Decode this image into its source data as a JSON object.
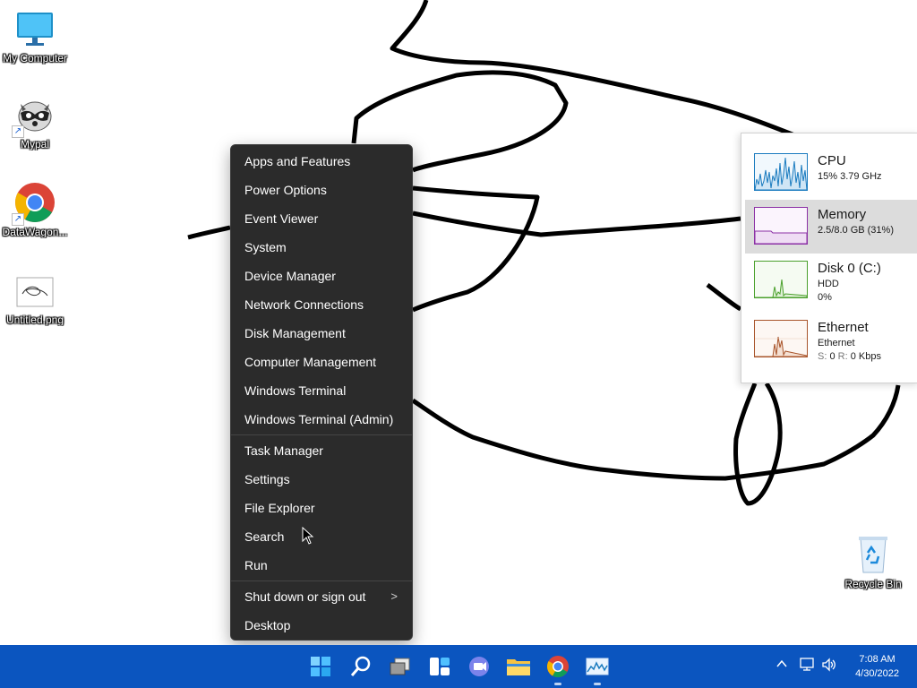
{
  "desktop": {
    "icons": [
      {
        "label": "My Computer",
        "icon": "monitor-icon"
      },
      {
        "label": "Mypal",
        "icon": "raccoon-browser-icon"
      },
      {
        "label": "DataWagon...",
        "icon": "chrome-icon"
      },
      {
        "label": "Untitled.png",
        "icon": "image-file-icon"
      },
      {
        "label": "Recycle Bin",
        "icon": "recycle-bin-icon"
      }
    ]
  },
  "winx_menu": {
    "items": [
      "Apps and Features",
      "Power Options",
      "Event Viewer",
      "System",
      "Device Manager",
      "Network Connections",
      "Disk Management",
      "Computer Management",
      "Windows Terminal",
      "Windows Terminal (Admin)",
      "Task Manager",
      "Settings",
      "File Explorer",
      "Search",
      "Run",
      "Shut down or sign out",
      "Desktop"
    ],
    "submenu_glyph": ">"
  },
  "perf_panel": {
    "cpu": {
      "title": "CPU",
      "sub": "15%  3.79 GHz",
      "color": "#1a7bbf"
    },
    "memory": {
      "title": "Memory",
      "sub": "2.5/8.0 GB (31%)",
      "color": "#8b2fa5"
    },
    "disk": {
      "title": "Disk 0 (C:)",
      "sub1": "HDD",
      "sub2": "0%",
      "color": "#4aa02c"
    },
    "ethernet": {
      "title": "Ethernet",
      "sub1": "Ethernet",
      "sub2_s": "S:",
      "sub2_s_val": "0",
      "sub2_r": "R:",
      "sub2_r_val": "0 Kbps",
      "color": "#a8542a"
    }
  },
  "taskbar": {
    "apps": [
      "start-icon",
      "search-icon",
      "task-view-icon",
      "widgets-icon",
      "teams-chat-icon",
      "file-explorer-icon",
      "chrome-icon",
      "task-manager-icon"
    ],
    "tray": [
      "chevron-up-icon",
      "network-icon",
      "volume-icon"
    ],
    "time": "7:08 AM",
    "date": "4/30/2022",
    "accent": "#0b55bf"
  }
}
